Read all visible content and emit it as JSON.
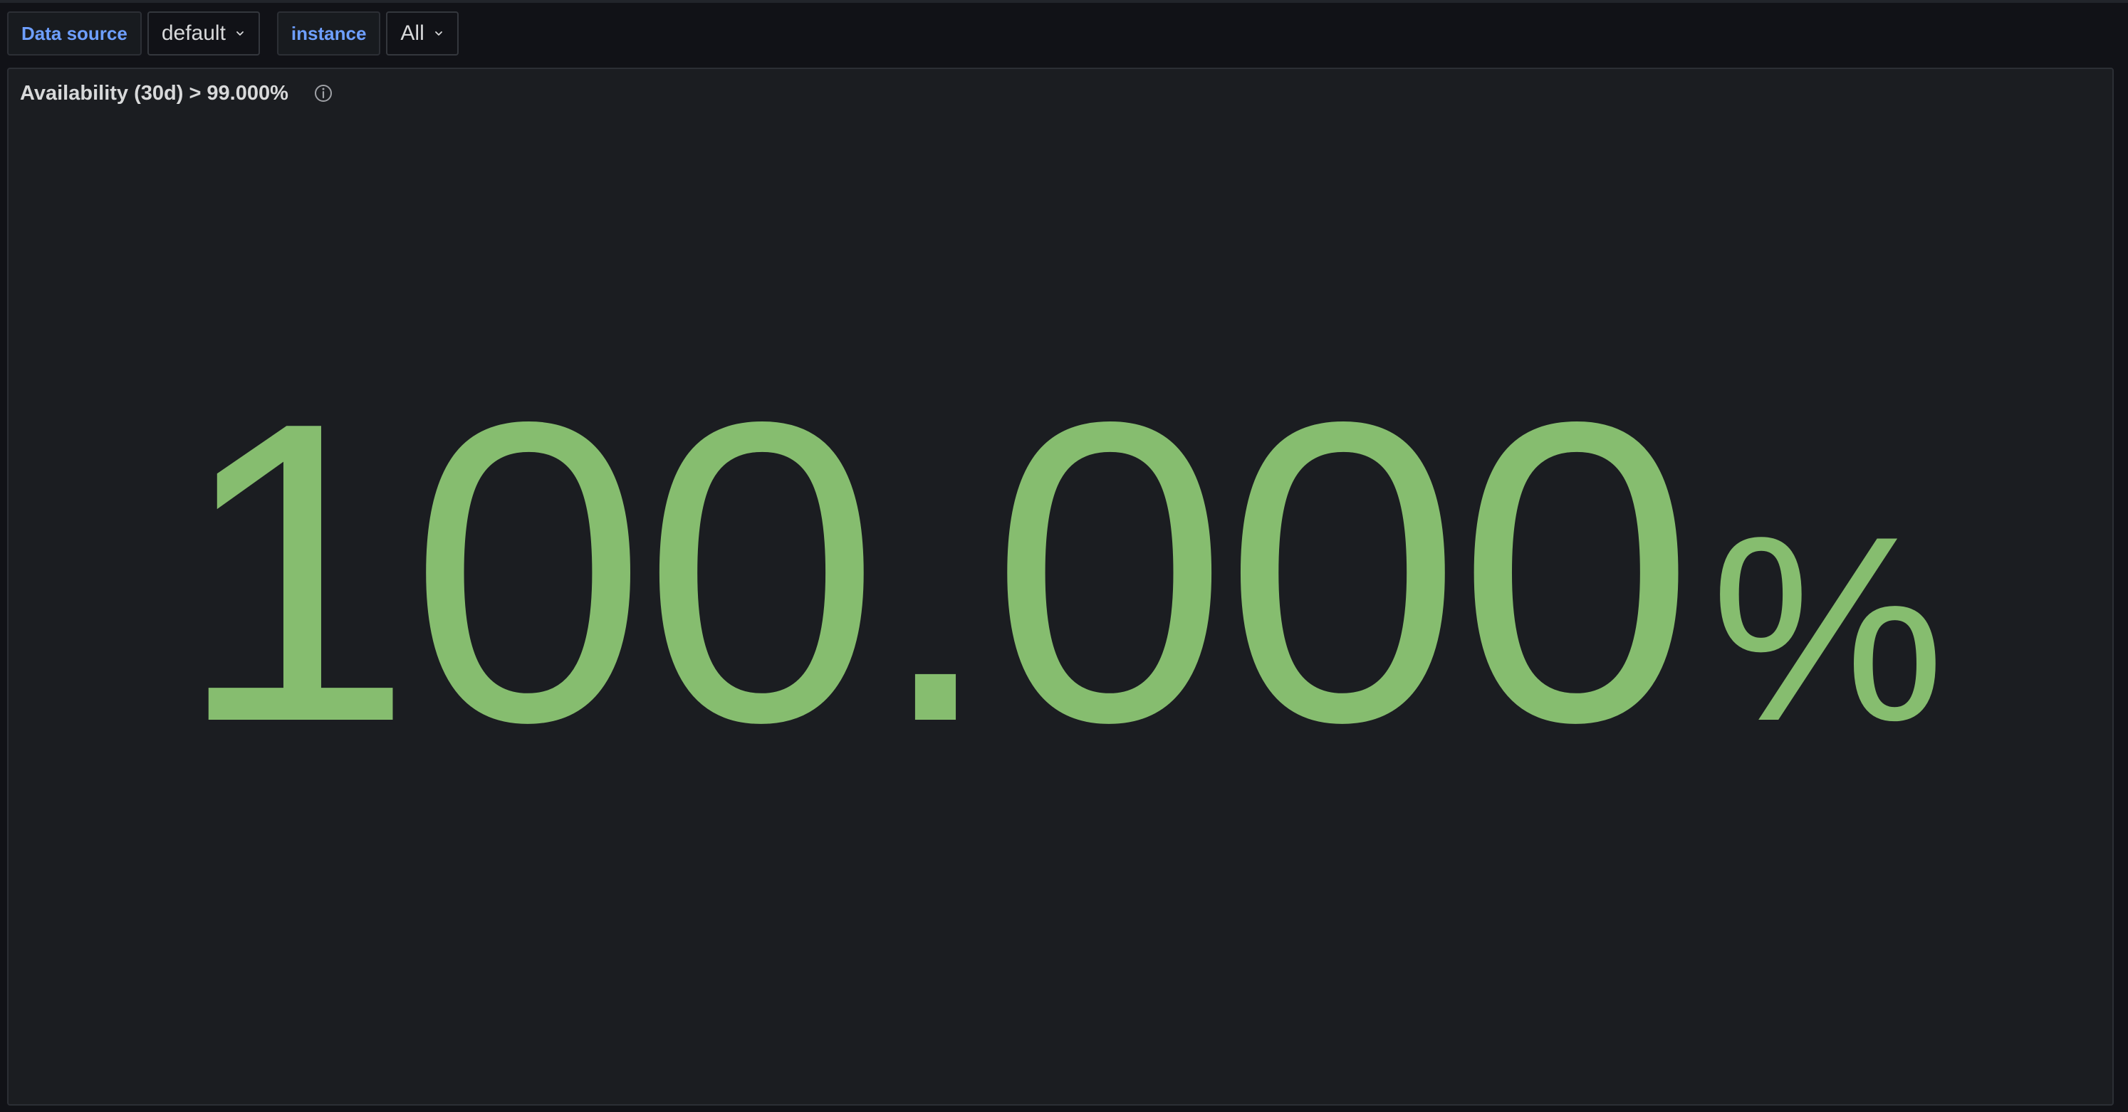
{
  "variables": [
    {
      "label": "Data source",
      "value": "default"
    },
    {
      "label": "instance",
      "value": "All"
    }
  ],
  "panel": {
    "title": "Availability (30d) > 99.000%",
    "info_icon": "info-circle-icon",
    "stat": {
      "value": "100.000",
      "unit": "%",
      "color": "#86bd6f"
    }
  },
  "colors": {
    "background": "#111217",
    "panel": "#1b1d21",
    "variable_label": "#6e9fff",
    "text": "#d8d9da"
  }
}
